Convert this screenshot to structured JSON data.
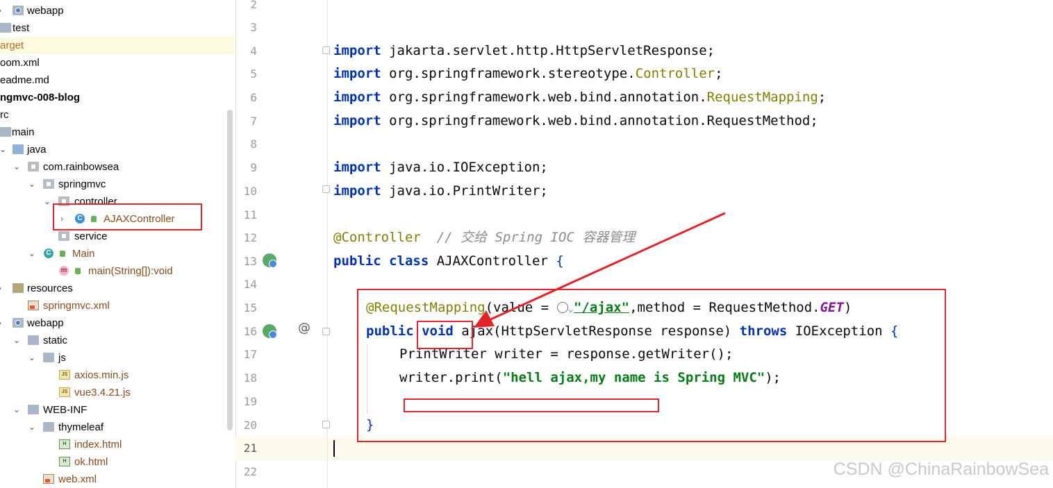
{
  "tree": {
    "items": [
      {
        "label": "webapp",
        "icon": "web-folder-icon"
      },
      {
        "label": "test",
        "icon": "folder-icon"
      },
      {
        "label": "arget",
        "icon": "none"
      },
      {
        "label": "oom.xml",
        "icon": "none"
      },
      {
        "label": "eadme.md",
        "icon": "none"
      },
      {
        "label": "ngmvc-008-blog",
        "icon": "none"
      },
      {
        "label": "rc",
        "icon": "none"
      },
      {
        "label": "main",
        "icon": "folder-icon"
      },
      {
        "label": "java",
        "icon": "source-folder-icon"
      },
      {
        "label": "com.rainbowsea",
        "icon": "package-icon"
      },
      {
        "label": "springmvc",
        "icon": "package-icon"
      },
      {
        "label": "controller",
        "icon": "package-icon"
      },
      {
        "label": "AJAXController",
        "icon": "class-icon"
      },
      {
        "label": "service",
        "icon": "package-icon"
      },
      {
        "label": "Main",
        "icon": "run-class-icon"
      },
      {
        "label": "main(String[]):void",
        "icon": "method-icon"
      },
      {
        "label": "resources",
        "icon": "resources-folder-icon"
      },
      {
        "label": "springmvc.xml",
        "icon": "xml-file-icon"
      },
      {
        "label": "webapp",
        "icon": "web-folder-icon"
      },
      {
        "label": "static",
        "icon": "folder-icon"
      },
      {
        "label": "js",
        "icon": "folder-icon"
      },
      {
        "label": "axios.min.js",
        "icon": "js-file-icon"
      },
      {
        "label": "vue3.4.21.js",
        "icon": "js-file-icon"
      },
      {
        "label": "WEB-INF",
        "icon": "folder-icon"
      },
      {
        "label": "thymeleaf",
        "icon": "folder-icon"
      },
      {
        "label": "index.html",
        "icon": "html-file-icon"
      },
      {
        "label": "ok.html",
        "icon": "html-file-icon"
      },
      {
        "label": "web.xml",
        "icon": "xml-file-icon"
      }
    ]
  },
  "editor": {
    "line_numbers": [
      "2",
      "3",
      "4",
      "5",
      "6",
      "7",
      "8",
      "9",
      "10",
      "11",
      "12",
      "13",
      "14",
      "15",
      "16",
      "17",
      "18",
      "19",
      "20",
      "21",
      "22"
    ],
    "current_line": "21",
    "code": {
      "l4_kw": "import",
      "l4_rest": " jakarta.servlet.http.HttpServletResponse;",
      "l5_kw": "import",
      "l5_a": " org.springframework.stereotype.",
      "l5_b": "Controller",
      "l5_c": ";",
      "l6_kw": "import",
      "l6_a": " org.springframework.web.bind.annotation.",
      "l6_b": "RequestMapping",
      "l6_c": ";",
      "l7_kw": "import",
      "l7_rest": " org.springframework.web.bind.annotation.RequestMethod;",
      "l9_kw": "import",
      "l9_rest": " java.io.IOException;",
      "l10_kw": "import",
      "l10_rest": " java.io.PrintWriter;",
      "l12_ann": "@Controller",
      "l12_cmt": "  // 交给 Spring IOC 容器管理",
      "l13_kw1": "public",
      "l13_kw2": "class",
      "l13_rest": " AJAXController ",
      "l13_brace": "{",
      "l15_ann": "@RequestMapping",
      "l15_a": "(value = ",
      "l15_str": "\"/ajax\"",
      "l15_b": ",method = RequestMethod.",
      "l15_const": "GET",
      "l15_c": ")",
      "l16_kw1": "public",
      "l16_kw2": "void",
      "l16_a": " ajax(HttpServletResponse response) ",
      "l16_kw3": "throws",
      "l16_b": " IOException ",
      "l16_brace": "{",
      "l17": "PrintWriter writer = response.getWriter();",
      "l18_a": "writer.print(",
      "l18_str": "\"hell ajax,my name is Spring MVC\"",
      "l18_b": ");",
      "l20": "}"
    }
  },
  "watermark": "CSDN @ChinaRainbowSea",
  "colors": {
    "annotation_red": "#e2232a",
    "keyword": "#0033b3",
    "string": "#067d17",
    "annotation": "#808000"
  }
}
